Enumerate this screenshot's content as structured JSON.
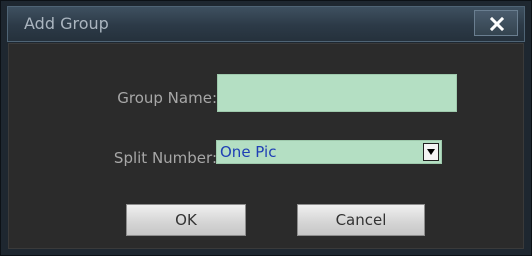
{
  "dialog": {
    "title": "Add Group",
    "close_label": "×"
  },
  "form": {
    "group_name_label": "Group Name:",
    "group_name_value": "",
    "split_number_label": "Split Number:",
    "split_number_value": "One Pic"
  },
  "buttons": {
    "ok_label": "OK",
    "cancel_label": "Cancel"
  },
  "colors": {
    "input_background": "#b4dfc3",
    "value_text": "#1f3fb5",
    "titlebar": "#2c3a47",
    "body_background": "#2b2b2b"
  },
  "icons": {
    "close": "close-icon",
    "dropdown": "chevron-down-icon"
  }
}
